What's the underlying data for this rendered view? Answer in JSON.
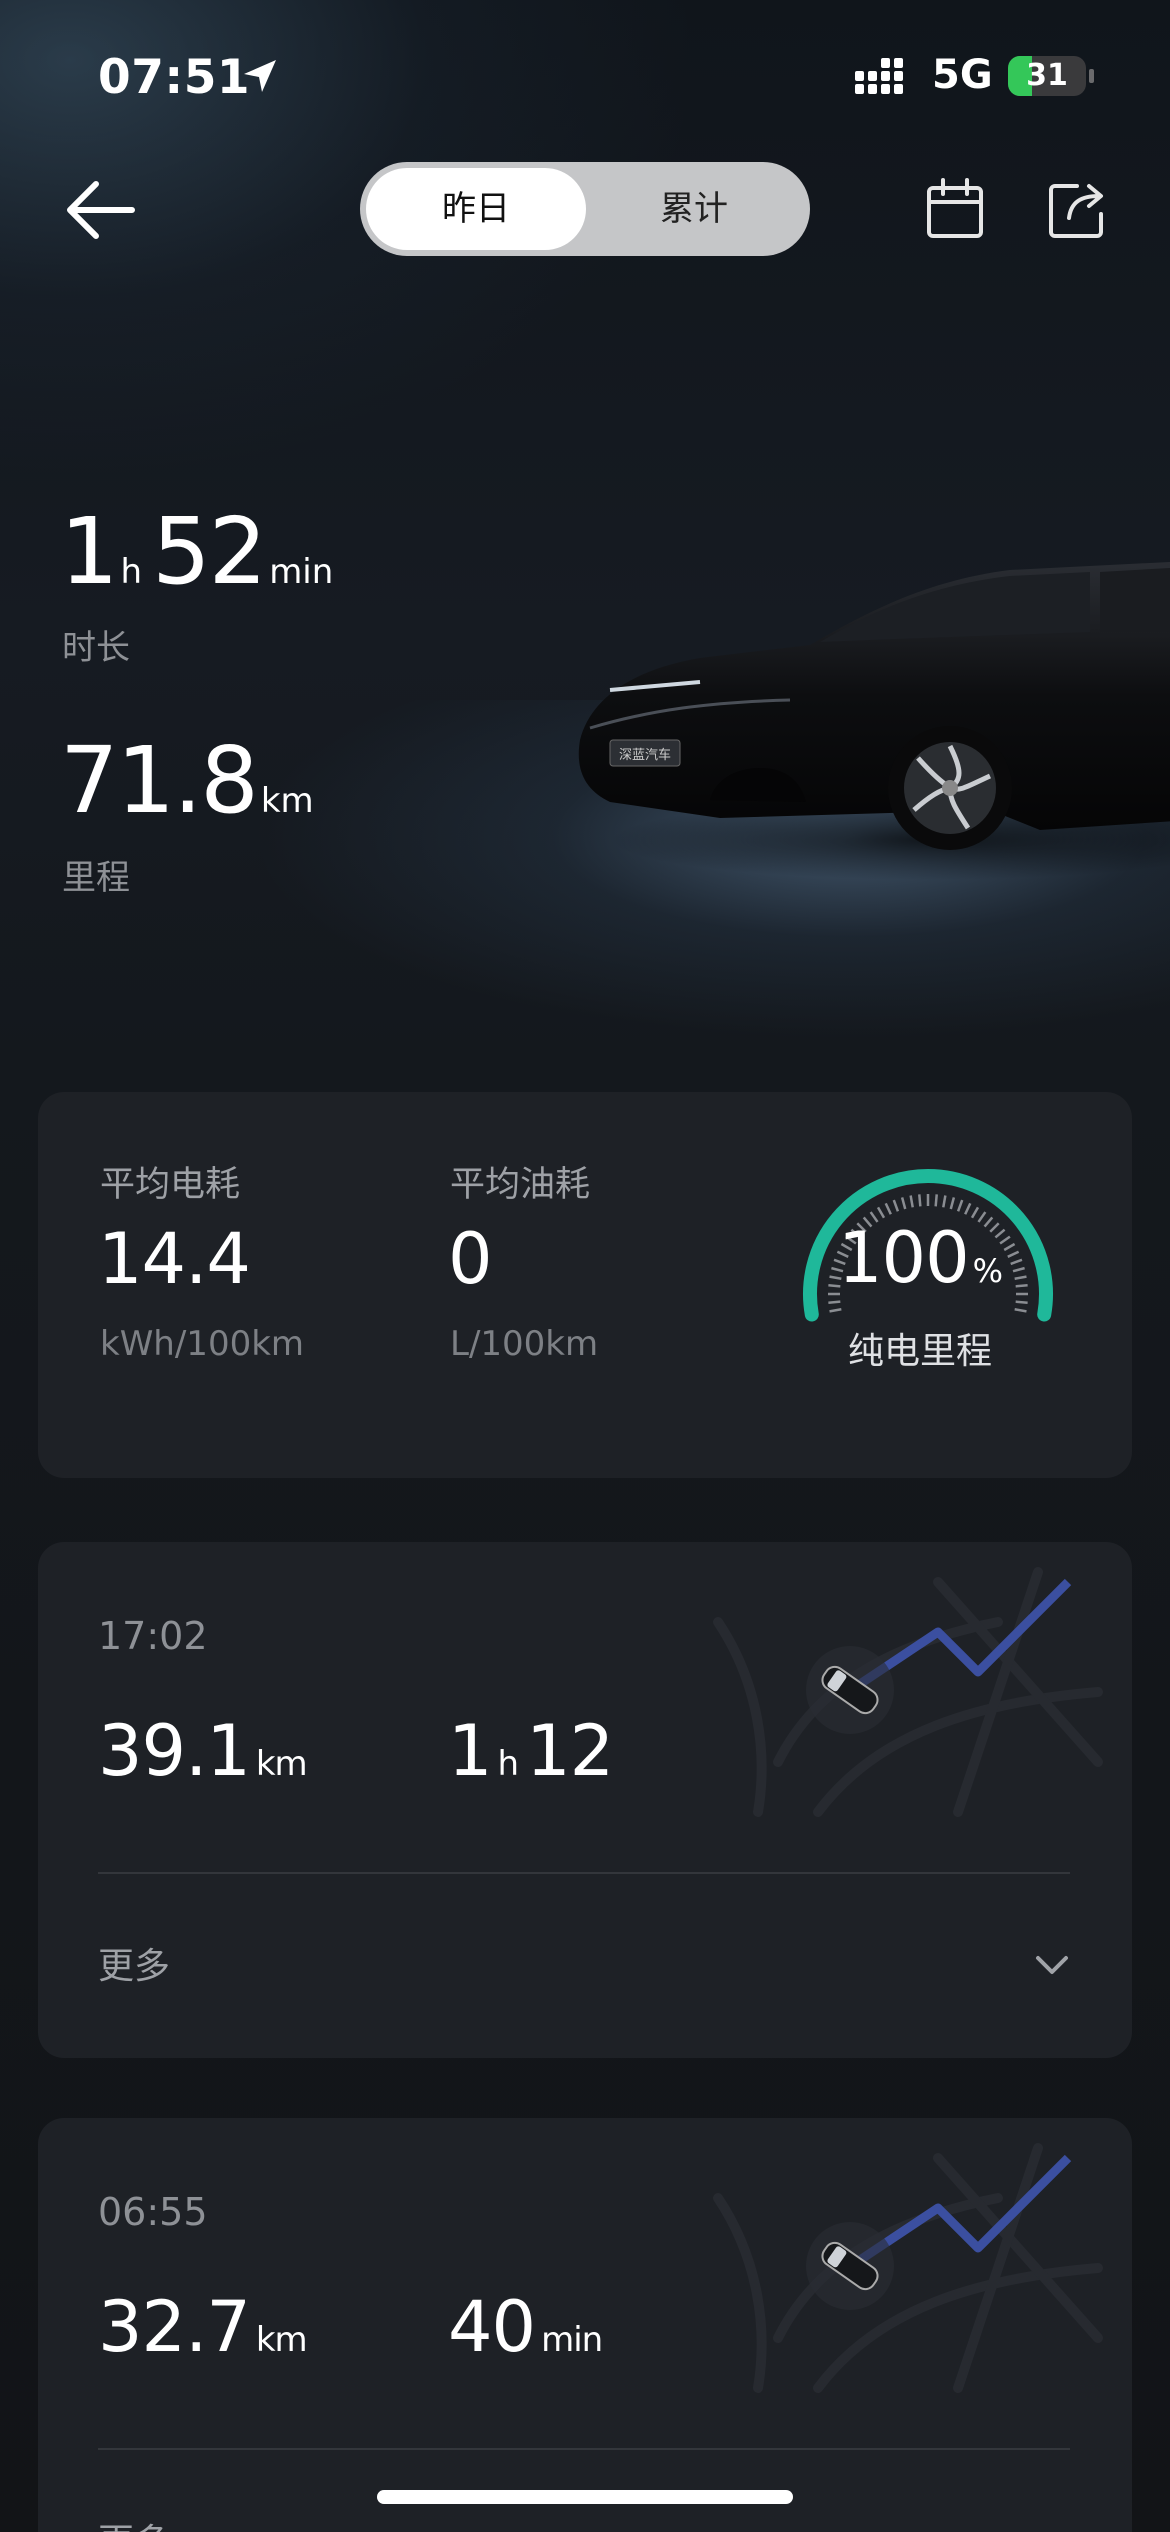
{
  "status_bar": {
    "time": "07:51",
    "network": "5G",
    "battery": "31",
    "battery_level": 0.31
  },
  "header": {
    "tabs": [
      {
        "label": "昨日",
        "active": true
      },
      {
        "label": "累计",
        "active": false
      }
    ]
  },
  "summary": {
    "duration": {
      "hours": "1",
      "hours_unit": "h",
      "minutes": "52",
      "minutes_unit": "min",
      "label": "时长"
    },
    "distance": {
      "value": "71.8",
      "unit": "km",
      "label": "里程"
    }
  },
  "metrics": {
    "avg_power": {
      "label": "平均电耗",
      "value": "14.4",
      "unit": "kWh/100km"
    },
    "avg_fuel": {
      "label": "平均油耗",
      "value": "0",
      "unit": "L/100km"
    },
    "pure_electric": {
      "value": "100",
      "unit": "%",
      "label": "纯电里程",
      "fraction": 1.0
    }
  },
  "trips": [
    {
      "time": "17:02",
      "distance": "39.1",
      "distance_unit": "km",
      "duration_a": "1",
      "duration_a_unit": "h",
      "duration_b": "12",
      "duration_b_unit": "",
      "more_label": "更多"
    },
    {
      "time": "06:55",
      "distance": "32.7",
      "distance_unit": "km",
      "duration_a": "40",
      "duration_a_unit": "min",
      "duration_b": "",
      "duration_b_unit": "",
      "more_label": "更多"
    }
  ],
  "colors": {
    "gauge": "#1fb89a",
    "route": "#3b4fa0",
    "battery": "#34c759"
  },
  "car_plate": "深蓝汽车"
}
